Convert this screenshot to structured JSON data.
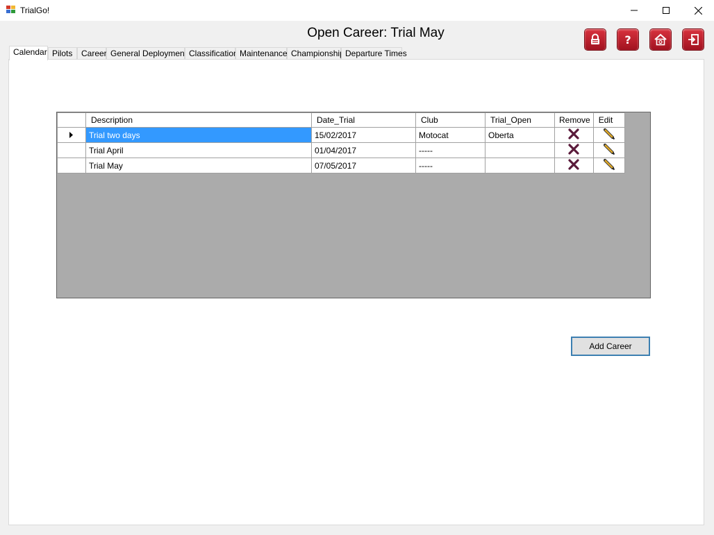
{
  "window": {
    "title": "TrialGo!"
  },
  "header": {
    "title": "Open Career: Trial May",
    "icons": [
      "lock-icon",
      "help-icon",
      "home-icon",
      "exit-icon"
    ]
  },
  "tabs": [
    {
      "label": "Calendar",
      "active": true
    },
    {
      "label": "Pilots"
    },
    {
      "label": "Career"
    },
    {
      "label": "General Deployments"
    },
    {
      "label": "Classification"
    },
    {
      "label": "Maintenance"
    },
    {
      "label": "Championship"
    },
    {
      "label": "Departure Times"
    }
  ],
  "grid": {
    "columns": [
      "Description",
      "Date_Trial",
      "Club",
      "Trial_Open",
      "Remove",
      "Edit"
    ],
    "rows": [
      {
        "description": "Trial two days",
        "date": "15/02/2017",
        "club": "Motocat",
        "open": "Oberta",
        "selected": true
      },
      {
        "description": "Trial April",
        "date": "01/04/2017",
        "club": "-----",
        "open": ""
      },
      {
        "description": "Trial May",
        "date": "07/05/2017",
        "club": "-----",
        "open": ""
      }
    ]
  },
  "actions": {
    "add_label": "Add Career"
  },
  "colors": {
    "selection": "#3399ff",
    "grid_background": "#ababab",
    "icon_red": "#c11c28",
    "remove_x": "#5a1a3a"
  }
}
